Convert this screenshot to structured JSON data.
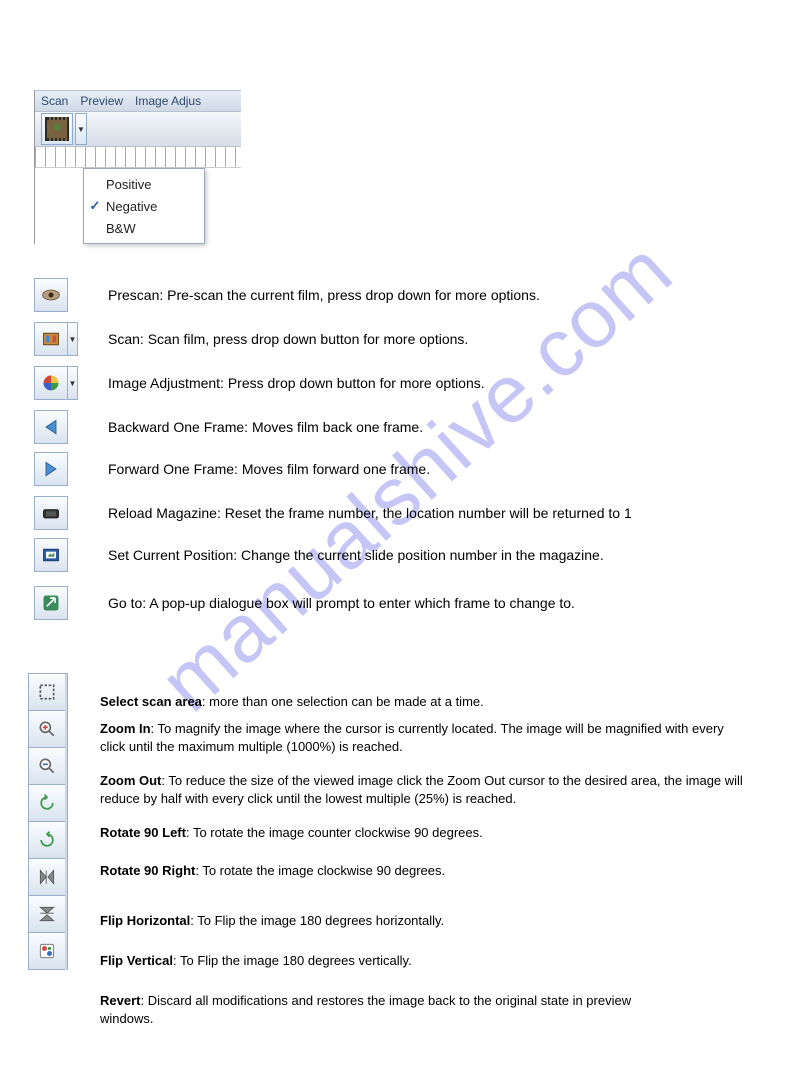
{
  "watermark": "manualshive.com",
  "menubar": {
    "scan": "Scan",
    "preview": "Preview",
    "image_adjust": "Image Adjus"
  },
  "popup": {
    "positive": "Positive",
    "negative": "Negative",
    "bw": "B&W",
    "check": "✓"
  },
  "rows": {
    "prescan": "Prescan: Pre-scan the current film, press drop down for more options.",
    "scan": "Scan: Scan film, press drop down   button for more options.",
    "image_adj": "Image Adjustment:  Press drop down    button for more options.",
    "backward": "Backward One Frame: Moves film back one frame.",
    "forward": "Forward One Frame: Moves film forward one frame.",
    "reload": "Reload Magazine: Reset the frame number, the location number will be returned to 1",
    "setpos": "Set Current Position: Change the current slide position number in the magazine.",
    "goto": "Go to: A pop-up dialogue box will prompt to enter which frame to change to."
  },
  "lower": {
    "select_b": "Select scan area",
    "select_t": ": more than one selection can be made at a time.",
    "zoomin_b": "Zoom In",
    "zoomin_t": ": To magnify the image where the cursor is currently located. The image will be magnified with every click until the maximum multiple (1000%) is reached.",
    "zoomout_b": "Zoom Out",
    "zoomout_t": ": To reduce the size of the viewed image click the Zoom Out cursor to the desired area, the image will reduce by half with every click until the lowest multiple (25%) is reached.",
    "rotleft_b": "Rotate 90 Left",
    "rotleft_t": ": To rotate the image counter clockwise 90 degrees.",
    "rotright_b": "Rotate 90 Right",
    "rotright_t": ": To rotate the image clockwise 90 degrees.",
    "fliph_b": "Flip Horizontal",
    "fliph_t": ": To Flip the image 180 degrees horizontally.",
    "flipv_b": "Flip Vertical",
    "flipv_t": ": To Flip the image 180 degrees vertically.",
    "revert_b": "Revert",
    "revert_t": ": Discard all modifications and restores the image back to the original state in preview windows."
  }
}
